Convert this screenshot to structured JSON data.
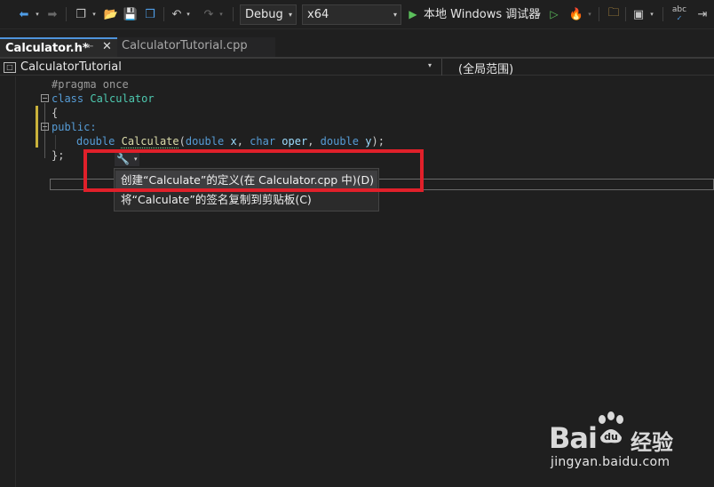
{
  "toolbar": {
    "config": "Debug",
    "platform": "x64",
    "run_label": "本地 Windows 调试器",
    "spell_label": "abc"
  },
  "tabs": [
    {
      "label": "Calculator.h*",
      "active": true
    },
    {
      "label": "CalculatorTutorial.cpp",
      "active": false
    }
  ],
  "navbar": {
    "project": "CalculatorTutorial",
    "scope": "(全局范围)"
  },
  "code": {
    "line1": "#pragma once",
    "line2_kw": "class",
    "line2_name": "Calculator",
    "line3": "{",
    "line4": "public:",
    "line5_type": "double",
    "line5_fn": "Calculate",
    "line5_p1type": "double",
    "line5_p1": "x",
    "line5_p2type": "char",
    "line5_p2": "oper",
    "line5_p3type": "double",
    "line5_p3": "y",
    "line6": "};"
  },
  "quick_actions": {
    "items": [
      {
        "label": "创建“Calculate”的定义(在 Calculator.cpp 中)(D)",
        "selected": true
      },
      {
        "label": "将“Calculate”的签名复制到剪贴板(C)",
        "selected": false
      }
    ]
  },
  "watermark": {
    "brand": "Bai",
    "brand_cn": "经验",
    "url": "jingyan.baidu.com"
  },
  "colors": {
    "highlight": "#e0202a",
    "accent": "#4e93db"
  }
}
